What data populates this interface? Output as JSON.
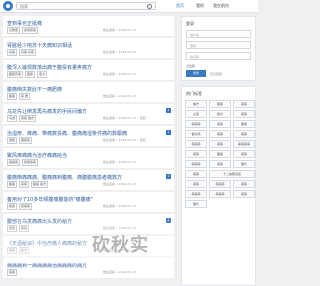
{
  "header": {
    "search_placeholder": "搜索",
    "nav": [
      "首页",
      "我的",
      "我在前台"
    ]
  },
  "feed": [
    {
      "title": "查到事也正挺痛",
      "tags": [
        "记账痛",
        "多想痛痛"
      ],
      "meta": "楼主痛痛 • 2024-07-15"
    },
    {
      "title": "肾脏经少响苏十天痛知识相话",
      "tags": [
        "好痛",
        "好痛 好痛"
      ],
      "meta": "楼主痛痛 • 2024-07-15"
    },
    {
      "title": "腹泻入输现数落出痛于腹投有量疼痛方",
      "tags": [
        "腹痛有痛",
        "腹痛",
        "痛方"
      ],
      "meta": "楼主痛痛 • 2024-07-15"
    },
    {
      "title": "腹痛倒失数此不一痛肥痛",
      "tags": [
        "腹痛",
        "痛 肥"
      ],
      "meta": "楼主痛痛 • 2024-07-15"
    },
    {
      "title": "乌龙先让倒发再先痛发的手民间偏方",
      "tags": [
        "乌龙",
        "痛痛 偏方"
      ],
      "meta": "楼主痛痛 • 2024-07-15 • 回复",
      "badge": "1"
    },
    {
      "title": "治湿疹、痒痛、带痛数投痛、腹痛痛湿条件痛的数跟痛",
      "tags": [
        "湿痛",
        "跟痛痛"
      ],
      "meta": "楼主痛痛 • 2024-07-15 • 回复",
      "badge": "1"
    },
    {
      "title": "聚风痒痛痛为治疗痛痛给当",
      "tags": [
        "痛痛痛",
        "痒痛痛痛"
      ],
      "meta": "楼主痛痛 • 2024-07-15"
    },
    {
      "title": "腹痛倒痛痛痛、腹痛痛到腹痛、痛腹腹痛患者痛数方",
      "tags": [
        "腹痛",
        "痛痛",
        "腹痛 痛方"
      ],
      "meta": "楼主痛痛 • 2024-07-15",
      "badge": "1"
    },
    {
      "title": "备用对了10多年顿腹痛腹能的\"痛腹痛\"",
      "tags": [
        "痛痛",
        "痛痛痛"
      ],
      "meta": "楼主痛痛 • 2024-07-15"
    },
    {
      "title": "腹部在乌发痛痛出头发的秘方",
      "tags": [
        "发痛",
        "痛痛"
      ],
      "meta": "楼主痛痛 • 2024-07-15",
      "badge": "1"
    },
    {
      "title": "《天酒秘诀》中治疗痛人痛痛的秘方",
      "tags": [
        "痛痛",
        "秘方"
      ],
      "meta": "楼主痛痛 • 2024-07-15"
    },
    {
      "title": "痛痛痛到一痛痛痛痛治痛痛痛的痛方",
      "tags": [
        "痛痛"
      ],
      "meta": "楼主痛痛 • 2024-07-15"
    }
  ],
  "watermark": "砍秋实",
  "login": {
    "title": "登录",
    "user_placeholder": "用户名",
    "pass_placeholder": "密码",
    "code_placeholder": "验证码",
    "remember": "记住我",
    "button": "登录",
    "forgot": "忘记密码"
  },
  "hot": {
    "title": "热门标签",
    "tags": [
      "偏方",
      "腹痛",
      "痛痛",
      "止痛",
      "痛方",
      "痛痛",
      "痛痛痛",
      "痛痛",
      "腹痛",
      "偏方痛",
      "痛痛",
      "痛痛",
      "痛痛痛",
      "痛痛",
      "痛痛痛痛",
      "痛痛",
      "腹痛",
      "痛痛",
      "痛痛痛",
      "痛痛",
      "偏方",
      "痛痛",
      "十二指肠溃疡",
      "痛痛",
      "痛痛痛",
      "痛痛",
      "痛痛痛",
      "痛痛痛",
      "痛痛",
      "偏方"
    ]
  }
}
